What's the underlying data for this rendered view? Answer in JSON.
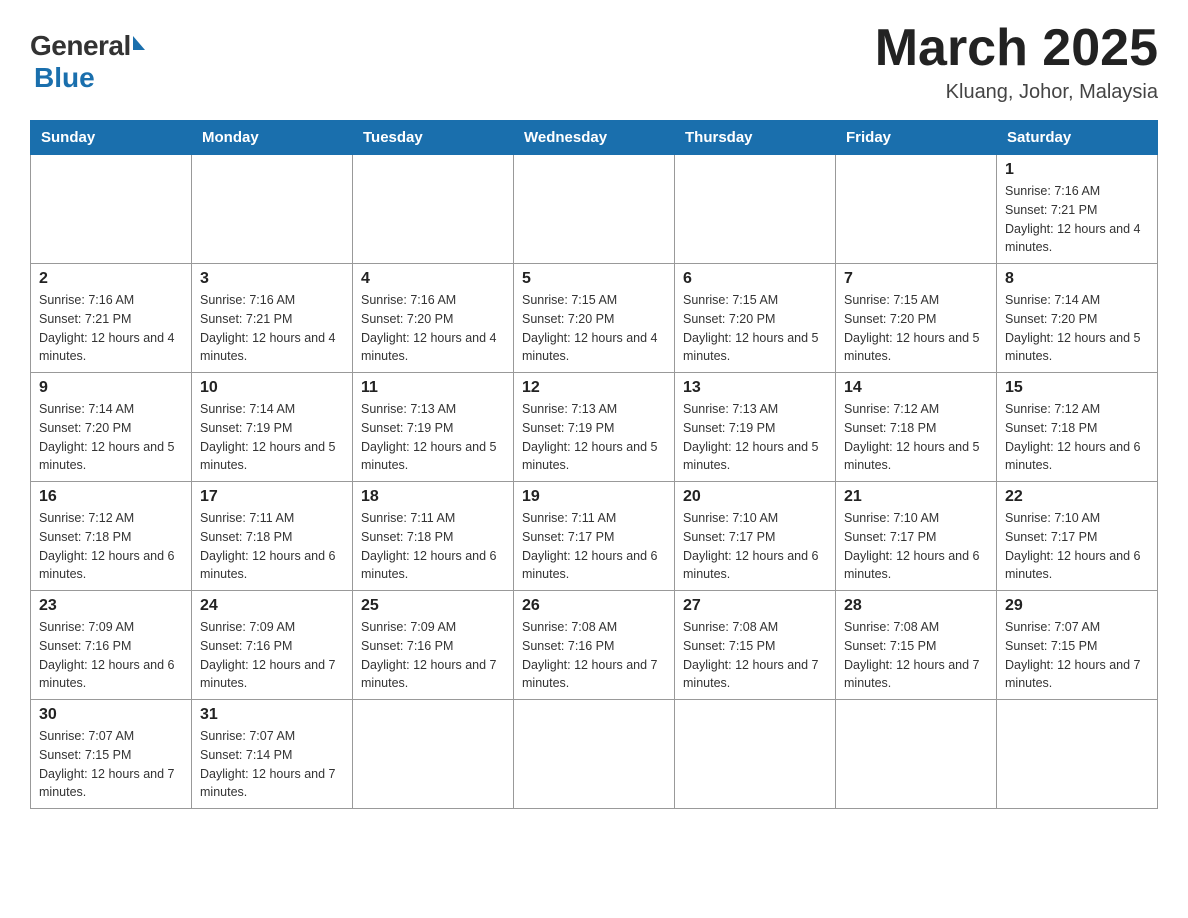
{
  "header": {
    "logo_general": "General",
    "logo_blue": "Blue",
    "month_title": "March 2025",
    "location": "Kluang, Johor, Malaysia"
  },
  "days_of_week": [
    "Sunday",
    "Monday",
    "Tuesday",
    "Wednesday",
    "Thursday",
    "Friday",
    "Saturday"
  ],
  "weeks": [
    [
      null,
      null,
      null,
      null,
      null,
      null,
      {
        "day": "1",
        "sunrise": "Sunrise: 7:16 AM",
        "sunset": "Sunset: 7:21 PM",
        "daylight": "Daylight: 12 hours and 4 minutes."
      }
    ],
    [
      {
        "day": "2",
        "sunrise": "Sunrise: 7:16 AM",
        "sunset": "Sunset: 7:21 PM",
        "daylight": "Daylight: 12 hours and 4 minutes."
      },
      {
        "day": "3",
        "sunrise": "Sunrise: 7:16 AM",
        "sunset": "Sunset: 7:21 PM",
        "daylight": "Daylight: 12 hours and 4 minutes."
      },
      {
        "day": "4",
        "sunrise": "Sunrise: 7:16 AM",
        "sunset": "Sunset: 7:20 PM",
        "daylight": "Daylight: 12 hours and 4 minutes."
      },
      {
        "day": "5",
        "sunrise": "Sunrise: 7:15 AM",
        "sunset": "Sunset: 7:20 PM",
        "daylight": "Daylight: 12 hours and 4 minutes."
      },
      {
        "day": "6",
        "sunrise": "Sunrise: 7:15 AM",
        "sunset": "Sunset: 7:20 PM",
        "daylight": "Daylight: 12 hours and 5 minutes."
      },
      {
        "day": "7",
        "sunrise": "Sunrise: 7:15 AM",
        "sunset": "Sunset: 7:20 PM",
        "daylight": "Daylight: 12 hours and 5 minutes."
      },
      {
        "day": "8",
        "sunrise": "Sunrise: 7:14 AM",
        "sunset": "Sunset: 7:20 PM",
        "daylight": "Daylight: 12 hours and 5 minutes."
      }
    ],
    [
      {
        "day": "9",
        "sunrise": "Sunrise: 7:14 AM",
        "sunset": "Sunset: 7:20 PM",
        "daylight": "Daylight: 12 hours and 5 minutes."
      },
      {
        "day": "10",
        "sunrise": "Sunrise: 7:14 AM",
        "sunset": "Sunset: 7:19 PM",
        "daylight": "Daylight: 12 hours and 5 minutes."
      },
      {
        "day": "11",
        "sunrise": "Sunrise: 7:13 AM",
        "sunset": "Sunset: 7:19 PM",
        "daylight": "Daylight: 12 hours and 5 minutes."
      },
      {
        "day": "12",
        "sunrise": "Sunrise: 7:13 AM",
        "sunset": "Sunset: 7:19 PM",
        "daylight": "Daylight: 12 hours and 5 minutes."
      },
      {
        "day": "13",
        "sunrise": "Sunrise: 7:13 AM",
        "sunset": "Sunset: 7:19 PM",
        "daylight": "Daylight: 12 hours and 5 minutes."
      },
      {
        "day": "14",
        "sunrise": "Sunrise: 7:12 AM",
        "sunset": "Sunset: 7:18 PM",
        "daylight": "Daylight: 12 hours and 5 minutes."
      },
      {
        "day": "15",
        "sunrise": "Sunrise: 7:12 AM",
        "sunset": "Sunset: 7:18 PM",
        "daylight": "Daylight: 12 hours and 6 minutes."
      }
    ],
    [
      {
        "day": "16",
        "sunrise": "Sunrise: 7:12 AM",
        "sunset": "Sunset: 7:18 PM",
        "daylight": "Daylight: 12 hours and 6 minutes."
      },
      {
        "day": "17",
        "sunrise": "Sunrise: 7:11 AM",
        "sunset": "Sunset: 7:18 PM",
        "daylight": "Daylight: 12 hours and 6 minutes."
      },
      {
        "day": "18",
        "sunrise": "Sunrise: 7:11 AM",
        "sunset": "Sunset: 7:18 PM",
        "daylight": "Daylight: 12 hours and 6 minutes."
      },
      {
        "day": "19",
        "sunrise": "Sunrise: 7:11 AM",
        "sunset": "Sunset: 7:17 PM",
        "daylight": "Daylight: 12 hours and 6 minutes."
      },
      {
        "day": "20",
        "sunrise": "Sunrise: 7:10 AM",
        "sunset": "Sunset: 7:17 PM",
        "daylight": "Daylight: 12 hours and 6 minutes."
      },
      {
        "day": "21",
        "sunrise": "Sunrise: 7:10 AM",
        "sunset": "Sunset: 7:17 PM",
        "daylight": "Daylight: 12 hours and 6 minutes."
      },
      {
        "day": "22",
        "sunrise": "Sunrise: 7:10 AM",
        "sunset": "Sunset: 7:17 PM",
        "daylight": "Daylight: 12 hours and 6 minutes."
      }
    ],
    [
      {
        "day": "23",
        "sunrise": "Sunrise: 7:09 AM",
        "sunset": "Sunset: 7:16 PM",
        "daylight": "Daylight: 12 hours and 6 minutes."
      },
      {
        "day": "24",
        "sunrise": "Sunrise: 7:09 AM",
        "sunset": "Sunset: 7:16 PM",
        "daylight": "Daylight: 12 hours and 7 minutes."
      },
      {
        "day": "25",
        "sunrise": "Sunrise: 7:09 AM",
        "sunset": "Sunset: 7:16 PM",
        "daylight": "Daylight: 12 hours and 7 minutes."
      },
      {
        "day": "26",
        "sunrise": "Sunrise: 7:08 AM",
        "sunset": "Sunset: 7:16 PM",
        "daylight": "Daylight: 12 hours and 7 minutes."
      },
      {
        "day": "27",
        "sunrise": "Sunrise: 7:08 AM",
        "sunset": "Sunset: 7:15 PM",
        "daylight": "Daylight: 12 hours and 7 minutes."
      },
      {
        "day": "28",
        "sunrise": "Sunrise: 7:08 AM",
        "sunset": "Sunset: 7:15 PM",
        "daylight": "Daylight: 12 hours and 7 minutes."
      },
      {
        "day": "29",
        "sunrise": "Sunrise: 7:07 AM",
        "sunset": "Sunset: 7:15 PM",
        "daylight": "Daylight: 12 hours and 7 minutes."
      }
    ],
    [
      {
        "day": "30",
        "sunrise": "Sunrise: 7:07 AM",
        "sunset": "Sunset: 7:15 PM",
        "daylight": "Daylight: 12 hours and 7 minutes."
      },
      {
        "day": "31",
        "sunrise": "Sunrise: 7:07 AM",
        "sunset": "Sunset: 7:14 PM",
        "daylight": "Daylight: 12 hours and 7 minutes."
      },
      null,
      null,
      null,
      null,
      null
    ]
  ]
}
